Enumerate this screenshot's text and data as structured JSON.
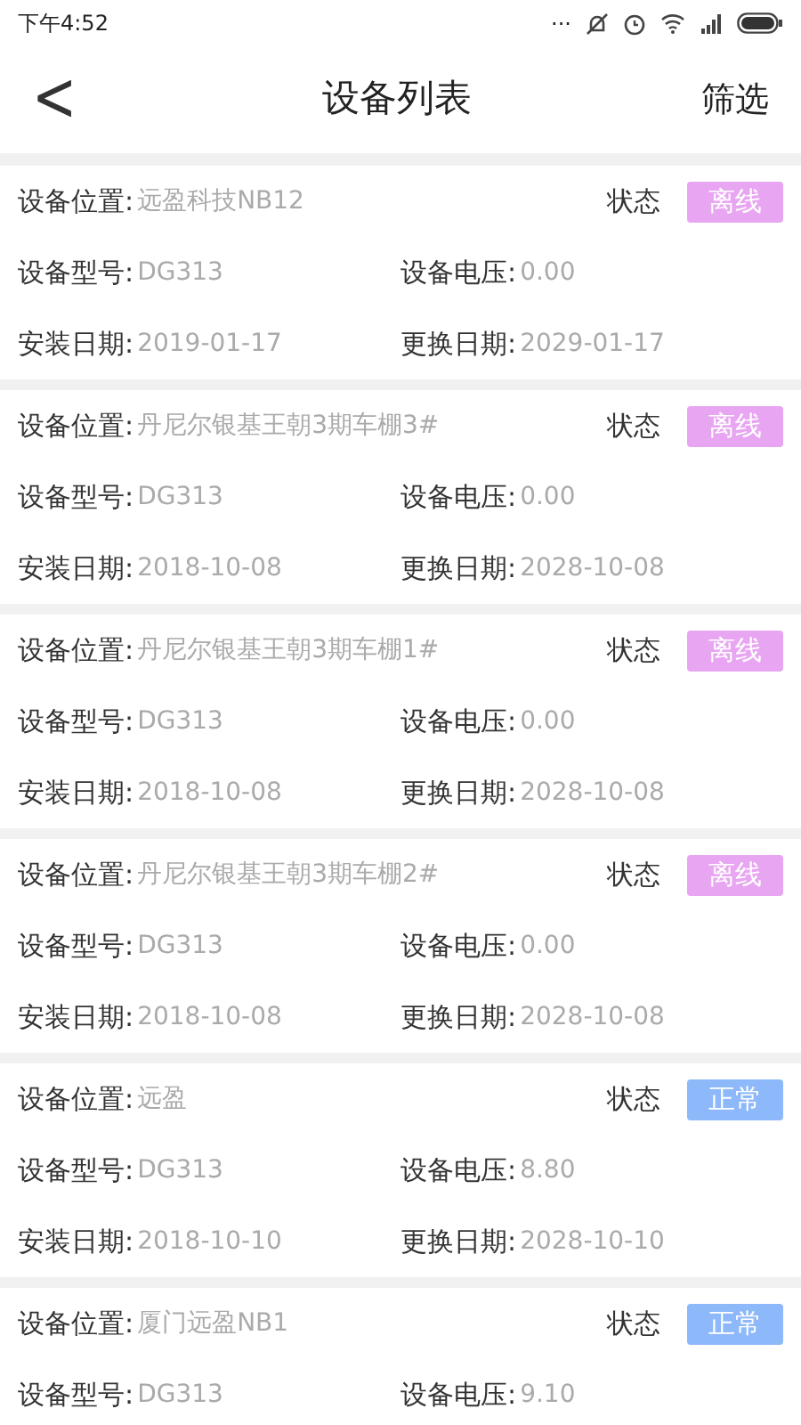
{
  "status_bar": {
    "time": "下午4:52",
    "more": "..."
  },
  "header": {
    "back": "<",
    "title": "设备列表",
    "action": "筛选"
  },
  "devices": [
    {
      "location": {
        "label": "设备位置:",
        "value": "远盈科技NB12"
      },
      "status_label": "状态",
      "status": {
        "text": "离线",
        "kind": "offline"
      },
      "fields": [
        {
          "label": "设备型号:",
          "value": "DG313"
        },
        {
          "label": "设备电压:",
          "value": "0.00"
        },
        {
          "label": "安装日期:",
          "value": "2019-01-17"
        },
        {
          "label": "更换日期:",
          "value": "2029-01-17"
        }
      ]
    },
    {
      "location": {
        "label": "设备位置:",
        "value": "丹尼尔银基王朝3期车棚3#"
      },
      "status_label": "状态",
      "status": {
        "text": "离线",
        "kind": "offline"
      },
      "fields": [
        {
          "label": "设备型号:",
          "value": "DG313"
        },
        {
          "label": "设备电压:",
          "value": "0.00"
        },
        {
          "label": "安装日期:",
          "value": "2018-10-08"
        },
        {
          "label": "更换日期:",
          "value": "2028-10-08"
        }
      ]
    },
    {
      "location": {
        "label": "设备位置:",
        "value": "丹尼尔银基王朝3期车棚1#"
      },
      "status_label": "状态",
      "status": {
        "text": "离线",
        "kind": "offline"
      },
      "fields": [
        {
          "label": "设备型号:",
          "value": "DG313"
        },
        {
          "label": "设备电压:",
          "value": "0.00"
        },
        {
          "label": "安装日期:",
          "value": "2018-10-08"
        },
        {
          "label": "更换日期:",
          "value": "2028-10-08"
        }
      ]
    },
    {
      "location": {
        "label": "设备位置:",
        "value": "丹尼尔银基王朝3期车棚2#"
      },
      "status_label": "状态",
      "status": {
        "text": "离线",
        "kind": "offline"
      },
      "fields": [
        {
          "label": "设备型号:",
          "value": "DG313"
        },
        {
          "label": "设备电压:",
          "value": "0.00"
        },
        {
          "label": "安装日期:",
          "value": "2018-10-08"
        },
        {
          "label": "更换日期:",
          "value": "2028-10-08"
        }
      ]
    },
    {
      "location": {
        "label": "设备位置:",
        "value": "远盈"
      },
      "status_label": "状态",
      "status": {
        "text": "正常",
        "kind": "normal"
      },
      "fields": [
        {
          "label": "设备型号:",
          "value": "DG313"
        },
        {
          "label": "设备电压:",
          "value": "8.80"
        },
        {
          "label": "安装日期:",
          "value": "2018-10-10"
        },
        {
          "label": "更换日期:",
          "value": "2028-10-10"
        }
      ]
    },
    {
      "location": {
        "label": "设备位置:",
        "value": "厦门远盈NB1"
      },
      "status_label": "状态",
      "status": {
        "text": "正常",
        "kind": "normal"
      },
      "fields": [
        {
          "label": "设备型号:",
          "value": "DG313"
        },
        {
          "label": "设备电压:",
          "value": "9.10"
        }
      ]
    }
  ]
}
